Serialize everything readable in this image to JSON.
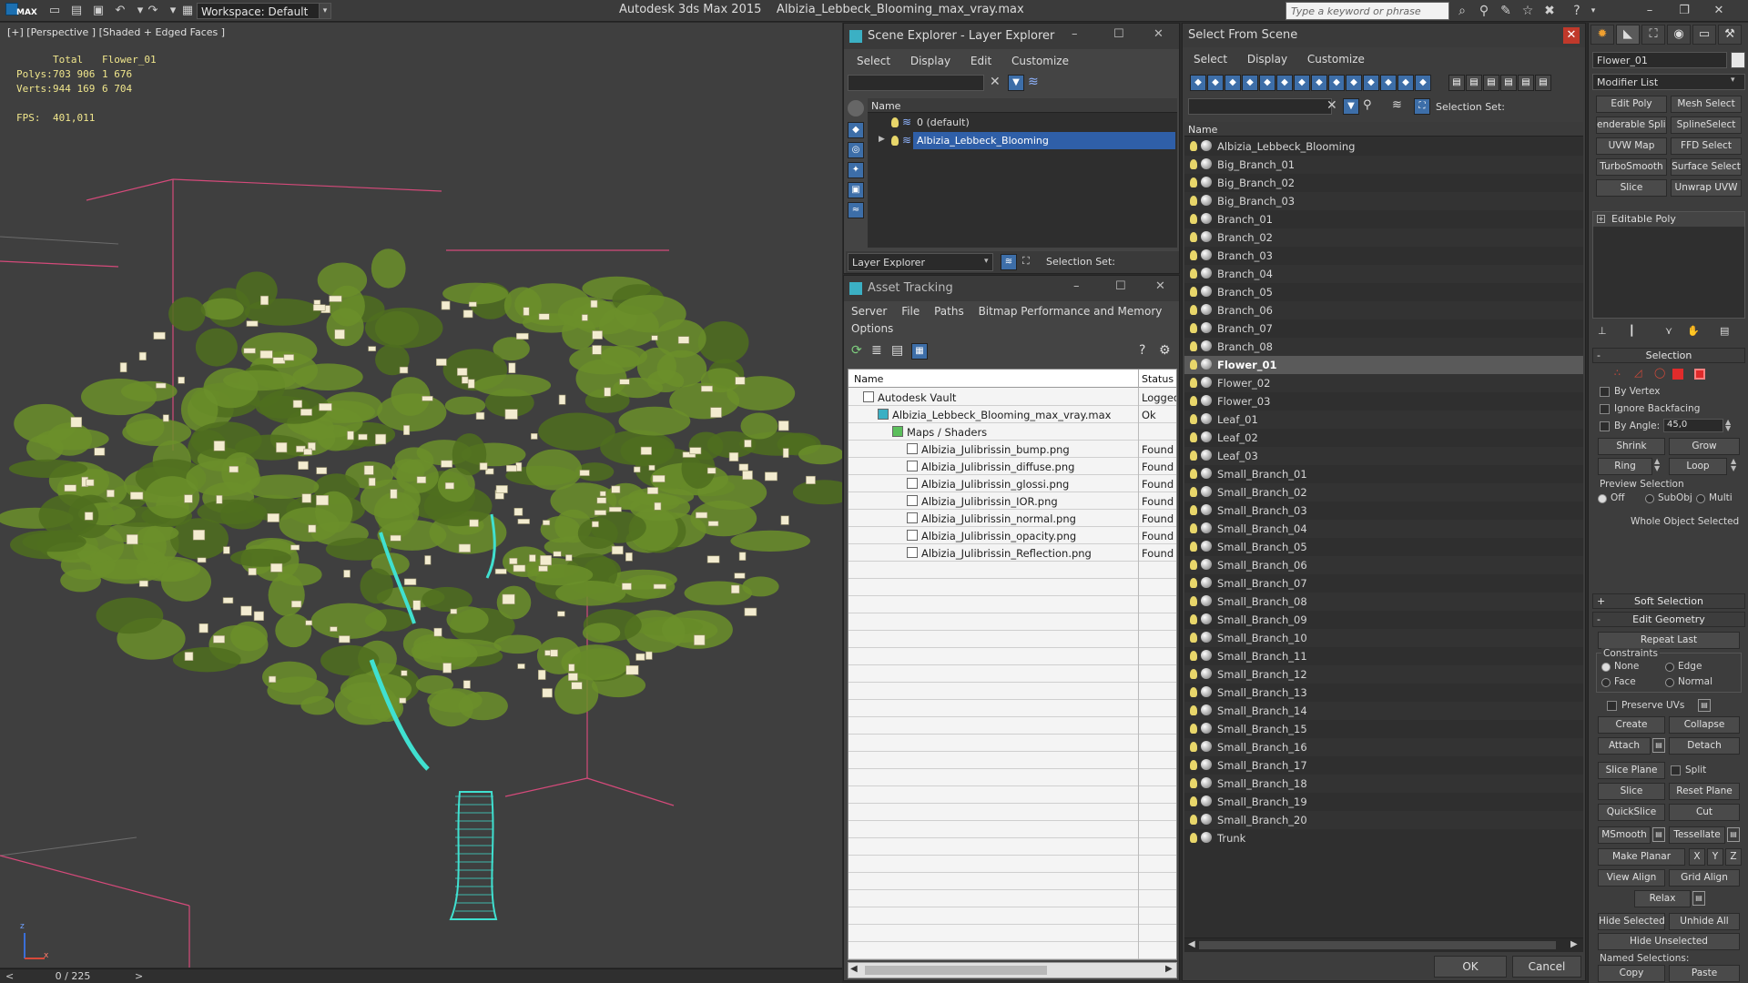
{
  "app": {
    "title": "Autodesk 3ds Max  2015",
    "file": "Albizia_Lebbeck_Blooming_max_vray.max",
    "workspace": "Workspace: Default",
    "search_placeholder": "Type a keyword or phrase",
    "logo": "MAX"
  },
  "viewport": {
    "label": "[+] [Perspective ] [Shaded + Edged Faces ]",
    "stats_headers": {
      "total": "Total",
      "object": "Flower_01"
    },
    "polys_label": "Polys:",
    "polys_total": "703 906",
    "polys_obj": "1 676",
    "verts_label": "Verts:",
    "verts_total": "944 169",
    "verts_obj": "6 704",
    "fps_label": "FPS:",
    "fps_value": "401,011",
    "axis_x": "x",
    "axis_z": "z"
  },
  "timeline": {
    "frame": "0 / 225",
    "prev": "<",
    "next": ">"
  },
  "scene_explorer": {
    "title": "Scene Explorer - Layer Explorer",
    "menu": [
      "Select",
      "Display",
      "Edit",
      "Customize"
    ],
    "col_name": "Name",
    "rows": [
      {
        "label": "0 (default)",
        "selected": false
      },
      {
        "label": "Albizia_Lebbeck_Blooming",
        "selected": true
      }
    ],
    "footer_dropdown": "Layer Explorer",
    "footer_selset": "Selection Set:"
  },
  "asset_tracking": {
    "title": "Asset Tracking",
    "menu": [
      "Server",
      "File",
      "Paths",
      "Bitmap Performance and Memory"
    ],
    "menu2": "Options",
    "col_name": "Name",
    "col_status": "Status",
    "rows": [
      {
        "name": "Autodesk Vault",
        "status": "Logged",
        "indent": 0
      },
      {
        "name": "Albizia_Lebbeck_Blooming_max_vray.max",
        "status": "Ok",
        "indent": 1
      },
      {
        "name": "Maps / Shaders",
        "status": "",
        "indent": 2
      },
      {
        "name": "Albizia_Julibrissin_bump.png",
        "status": "Found",
        "indent": 3
      },
      {
        "name": "Albizia_Julibrissin_diffuse.png",
        "status": "Found",
        "indent": 3
      },
      {
        "name": "Albizia_Julibrissin_glossi.png",
        "status": "Found",
        "indent": 3
      },
      {
        "name": "Albizia_Julibrissin_IOR.png",
        "status": "Found",
        "indent": 3
      },
      {
        "name": "Albizia_Julibrissin_normal.png",
        "status": "Found",
        "indent": 3
      },
      {
        "name": "Albizia_Julibrissin_opacity.png",
        "status": "Found",
        "indent": 3
      },
      {
        "name": "Albizia_Julibrissin_Reflection.png",
        "status": "Found",
        "indent": 3
      }
    ]
  },
  "select_from_scene": {
    "title": "Select From Scene",
    "menu": [
      "Select",
      "Display",
      "Customize"
    ],
    "selset": "Selection Set:",
    "col_name": "Name",
    "items": [
      "Albizia_Lebbeck_Blooming",
      "Big_Branch_01",
      "Big_Branch_02",
      "Big_Branch_03",
      "Branch_01",
      "Branch_02",
      "Branch_03",
      "Branch_04",
      "Branch_05",
      "Branch_06",
      "Branch_07",
      "Branch_08",
      "Flower_01",
      "Flower_02",
      "Flower_03",
      "Leaf_01",
      "Leaf_02",
      "Leaf_03",
      "Small_Branch_01",
      "Small_Branch_02",
      "Small_Branch_03",
      "Small_Branch_04",
      "Small_Branch_05",
      "Small_Branch_06",
      "Small_Branch_07",
      "Small_Branch_08",
      "Small_Branch_09",
      "Small_Branch_10",
      "Small_Branch_11",
      "Small_Branch_12",
      "Small_Branch_13",
      "Small_Branch_14",
      "Small_Branch_15",
      "Small_Branch_16",
      "Small_Branch_17",
      "Small_Branch_18",
      "Small_Branch_19",
      "Small_Branch_20",
      "Trunk"
    ],
    "selected": "Flower_01",
    "ok": "OK",
    "cancel": "Cancel"
  },
  "command_panel": {
    "object_name": "Flower_01",
    "modifier_list": "Modifier List",
    "mod_buttons": [
      "Edit Poly",
      "Mesh Select",
      "enderable Splin",
      "SplineSelect",
      "UVW Map",
      "FFD Select",
      "TurboSmooth",
      "Surface Select",
      "Slice",
      "Unwrap UVW"
    ],
    "stack_item": "Editable Poly",
    "selection": {
      "header": "Selection",
      "by_vertex": "By Vertex",
      "ignore_backfacing": "Ignore Backfacing",
      "by_angle": "By Angle:",
      "angle_value": "45,0",
      "shrink": "Shrink",
      "grow": "Grow",
      "ring": "Ring",
      "loop": "Loop",
      "preview_selection": "Preview Selection",
      "off": "Off",
      "subobj": "SubObj",
      "multi": "Multi",
      "status": "Whole Object Selected"
    },
    "soft_selection": "Soft Selection",
    "edit_geometry": {
      "header": "Edit Geometry",
      "repeat_last": "Repeat Last",
      "constraints": "Constraints",
      "none": "None",
      "edge": "Edge",
      "face": "Face",
      "normal": "Normal",
      "preserve_uvs": "Preserve UVs",
      "create": "Create",
      "collapse": "Collapse",
      "attach": "Attach",
      "detach": "Detach",
      "slice_plane": "Slice Plane",
      "split": "Split",
      "slice": "Slice",
      "reset_plane": "Reset Plane",
      "quickslice": "QuickSlice",
      "cut": "Cut",
      "msmooth": "MSmooth",
      "tessellate": "Tessellate",
      "make_planar": "Make Planar",
      "x": "X",
      "y": "Y",
      "z": "Z",
      "view_align": "View Align",
      "grid_align": "Grid Align",
      "relax": "Relax",
      "hide_selected": "Hide Selected",
      "unhide_all": "Unhide All",
      "hide_unselected": "Hide Unselected",
      "named_selections": "Named Selections:",
      "copy": "Copy",
      "paste": "Paste"
    }
  },
  "colors": {
    "accent_blue": "#2f5fa8",
    "foliage": "#6b8f2a",
    "trunk_wire": "#40e0d0",
    "bounds": "#d44a7a",
    "flower": "#f3ecd0"
  }
}
